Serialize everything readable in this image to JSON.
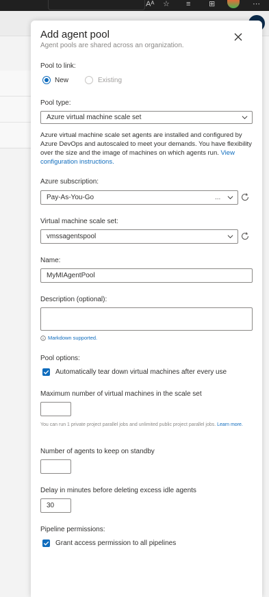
{
  "browser": {
    "toolbar_text": "Aᴬ"
  },
  "panel": {
    "title": "Add agent pool",
    "subtitle": "Agent pools are shared across an organization."
  },
  "pool_to_link": {
    "label": "Pool to link:",
    "options": [
      {
        "label": "New",
        "selected": true
      },
      {
        "label": "Existing",
        "selected": false
      }
    ]
  },
  "pool_type": {
    "label": "Pool type:",
    "value": "Azure virtual machine scale set",
    "description": "Azure virtual machine scale set agents are installed and configured by Azure DevOps and autoscaled to meet your demands. You have flexibility over the size and the image of machines on which agents run.",
    "link": "View configuration instructions."
  },
  "azure_subscription": {
    "label": "Azure subscription:",
    "value": "Pay-As-You-Go",
    "value_suffix": "..."
  },
  "vmss": {
    "label": "Virtual machine scale set:",
    "value": "vmssagentspool"
  },
  "name": {
    "label": "Name:",
    "value": "MyMIAgentPool"
  },
  "description_field": {
    "label": "Description (optional):",
    "value": "",
    "markdown_note": "Markdown supported."
  },
  "pool_options": {
    "label": "Pool options:",
    "teardown_label": "Automatically tear down virtual machines after every use",
    "teardown_checked": true
  },
  "max_vms": {
    "label": "Maximum number of virtual machines in the scale set",
    "value": "",
    "help": "You can run 1 private project parallel jobs and unlimited public project parallel jobs.",
    "help_link": "Learn more."
  },
  "standby": {
    "label": "Number of agents to keep on standby",
    "value": ""
  },
  "delay": {
    "label": "Delay in minutes before deleting excess idle agents",
    "value": "30"
  },
  "pipeline_permissions": {
    "label": "Pipeline permissions:",
    "grant_label": "Grant access permission to all pipelines",
    "grant_checked": true
  },
  "colors": {
    "accent": "#0f6cbd",
    "panel_bg": "#ffffff",
    "page_bg": "#f3f3f3",
    "border": "#8a8886",
    "browser_bar": "#202020"
  }
}
